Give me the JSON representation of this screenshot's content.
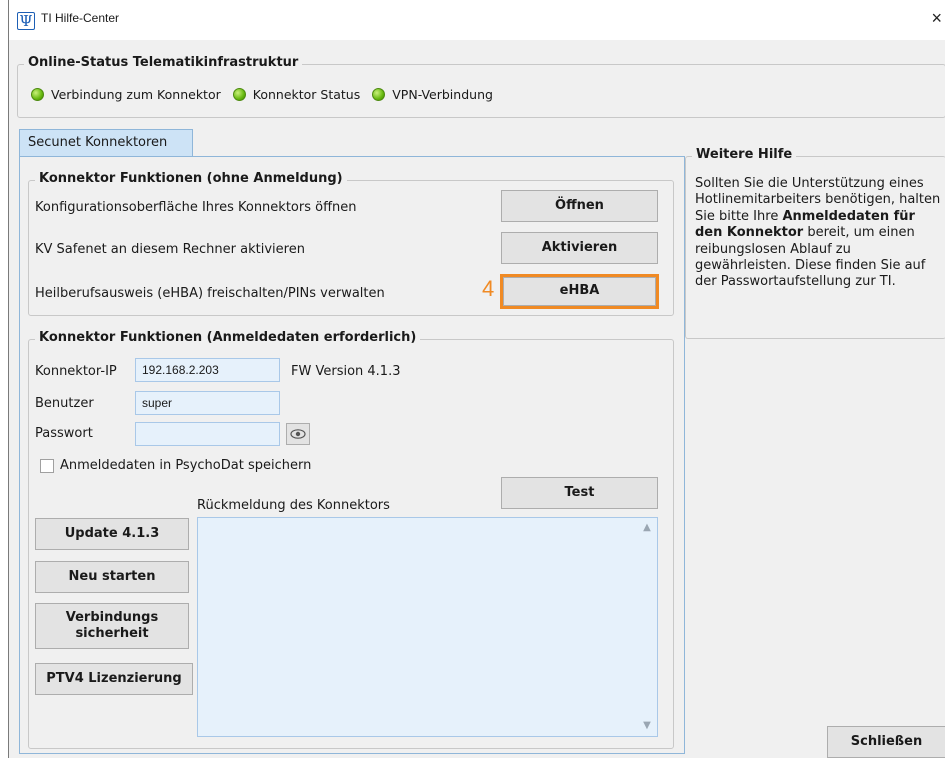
{
  "window": {
    "title": "TI Hilfe-Center",
    "app_icon_glyph": "Ψ",
    "close_glyph": "×"
  },
  "online_status": {
    "legend": "Online-Status Telematikinfrastruktur",
    "indicators": [
      {
        "label": "Verbindung zum Konnektor",
        "state": "ok",
        "color": "#66b80f"
      },
      {
        "label": "Konnektor Status",
        "state": "ok",
        "color": "#66b80f"
      },
      {
        "label": "VPN-Verbindung",
        "state": "ok",
        "color": "#66b80f"
      }
    ]
  },
  "tabs": [
    {
      "label": "Secunet Konnektoren",
      "active": true
    }
  ],
  "functions_no_login": {
    "legend": "Konnektor Funktionen (ohne Anmeldung)",
    "rows": [
      {
        "label": "Konfigurationsoberfläche Ihres Konnektors öffnen",
        "button": "Öffnen"
      },
      {
        "label": "KV Safenet an diesem Rechner aktivieren",
        "button": "Aktivieren"
      },
      {
        "label": "Heilberufsausweis (eHBA) freischalten/PINs verwalten",
        "button": "eHBA"
      }
    ],
    "step_marker": "4",
    "highlight_color": "#f08a24"
  },
  "functions_login": {
    "legend": "Konnektor Funktionen (Anmeldedaten erforderlich)",
    "ip_label": "Konnektor-IP",
    "ip_value": "192.168.2.203",
    "fw_version": "FW Version 4.1.3",
    "user_label": "Benutzer",
    "user_value": "super",
    "password_label": "Passwort",
    "password_value": "",
    "save_checkbox_label": "Anmeldedaten in PsychoDat speichern",
    "save_checked": false,
    "test_button": "Test",
    "feedback_label": "Rückmeldung des Konnektors",
    "feedback_text": "",
    "side_buttons": [
      "Update 4.1.3",
      "Neu starten",
      "Verbindungs sicherheit",
      "PTV4 Lizenzierung"
    ]
  },
  "help": {
    "legend": "Weitere Hilfe",
    "text_1": "Sollten Sie die Unterstützung eines Hotlinemitarbeiters benötigen, halten Sie bitte Ihre",
    "text_bold": "Anmeldedaten für den Konnektor",
    "text_2": "bereit, um einen reibungslosen Ablauf zu gewährleisten. Diese finden Sie auf der Passwortaufstellung zur TI."
  },
  "close_button": "Schließen"
}
